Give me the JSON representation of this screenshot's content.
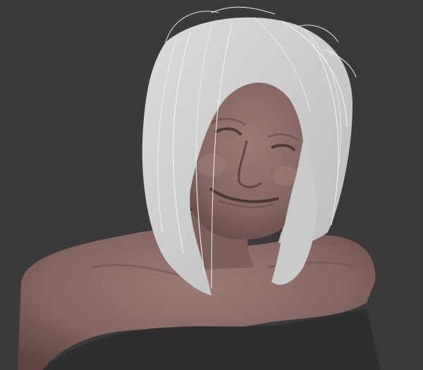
{
  "viewport": {
    "background_color": "#3a3a3a",
    "skin_color": "#8a6a66",
    "skin_shadow_color": "#5e4542",
    "hair_color": "#d2d4d4",
    "hair_strand_color": "#e6e8e8"
  },
  "scene": {
    "subject": "3d-bust-model",
    "icons": [
      "hair-mesh-icon",
      "head-mesh-icon",
      "bust-mesh-icon"
    ]
  }
}
